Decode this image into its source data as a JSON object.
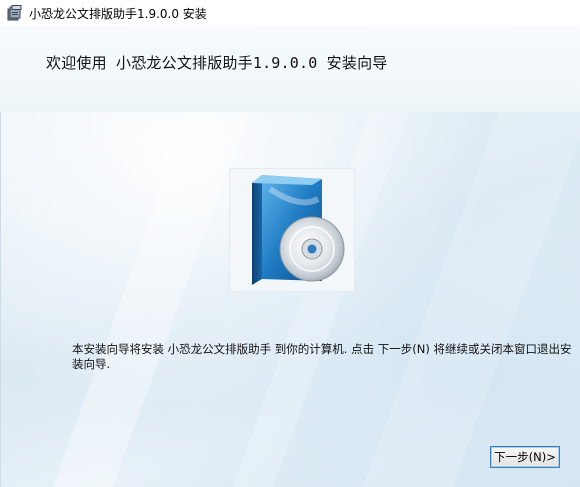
{
  "window": {
    "title": "小恐龙公文排版助手1.9.0.0 安装",
    "icon": "installer-icon"
  },
  "header": {
    "heading": "欢迎使用 小恐龙公文排版助手1.9.0.0 安装向导"
  },
  "main": {
    "image_icon": "software-box-cd-icon",
    "description": "本安装向导将安装 小恐龙公文排版助手 到你的计算机. 点击 下一步(N) 将继续或关闭本窗口退出安装向导."
  },
  "footer": {
    "next_label": "下一步(N)>"
  },
  "colors": {
    "box_blue": "#1e7ac2",
    "button_border": "#3c7fb1",
    "body_background": "#dbe9f3"
  }
}
